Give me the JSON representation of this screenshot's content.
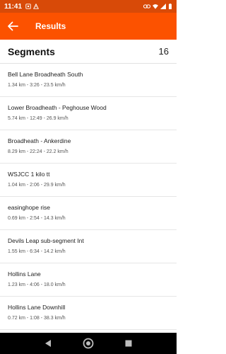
{
  "status_bar": {
    "time": "11:41",
    "left_icons": [
      "notification-icon",
      "warning-icon"
    ],
    "right_icons": [
      "link-icon",
      "wifi-icon",
      "signal-icon",
      "battery-icon"
    ]
  },
  "app_bar": {
    "title": "Results",
    "back_icon": "back-arrow-icon",
    "color": "#fc5200"
  },
  "header": {
    "title": "Segments",
    "count": "16"
  },
  "segments": [
    {
      "name": "Bell Lane Broadheath South",
      "stats": "1.34 km - 3:26 - 23.5 km/h"
    },
    {
      "name": "Lower Broadheath - Peghouse Wood",
      "stats": "5.74 km - 12:49 - 26.9 km/h"
    },
    {
      "name": "Broadheath - Ankerdine",
      "stats": "8.29 km - 22:24 - 22.2 km/h"
    },
    {
      "name": "WSJCC 1 kilo tt",
      "stats": "1.04 km - 2:06 - 29.9 km/h"
    },
    {
      "name": "easinghope rise",
      "stats": "0.69 km - 2:54 - 14.3 km/h"
    },
    {
      "name": "Devils Leap sub-segment Int",
      "stats": "1.55 km - 6:34 - 14.2 km/h"
    },
    {
      "name": "Hollins Lane",
      "stats": "1.23 km - 4:06 - 18.0 km/h"
    },
    {
      "name": "Hollins Lane Downhill",
      "stats": "0.72 km - 1:08 - 38.3 km/h"
    }
  ],
  "nav_bar": {
    "buttons": [
      "back-triangle-icon",
      "home-circle-icon",
      "recents-square-icon"
    ]
  }
}
